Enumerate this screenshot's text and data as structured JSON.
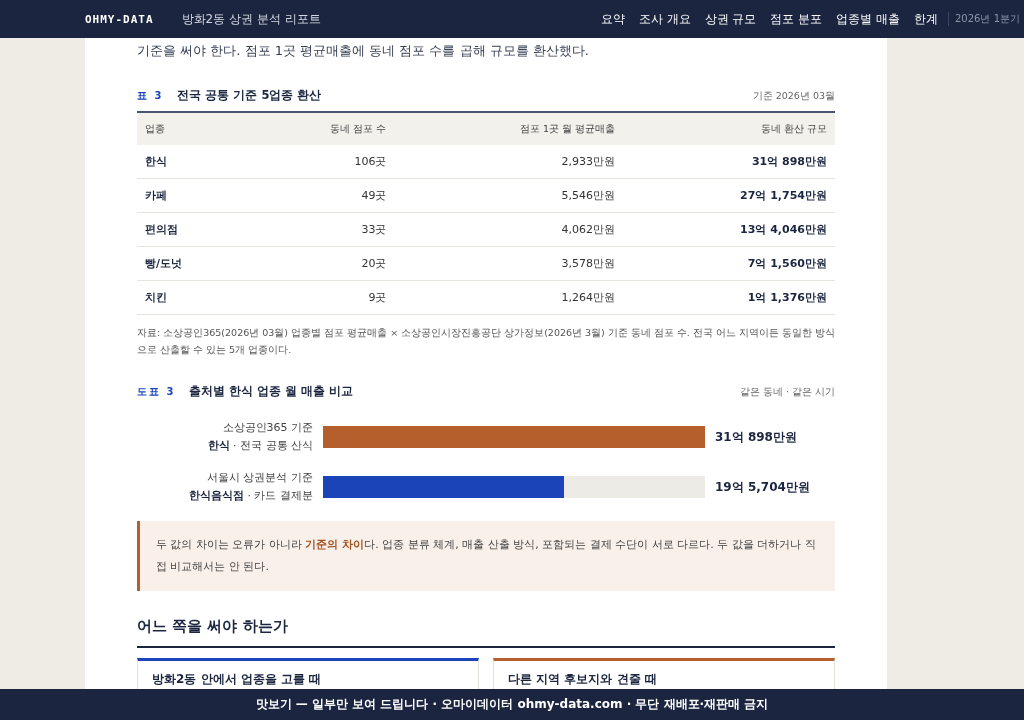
{
  "header": {
    "brand": "OHMY-DATA",
    "title": "방화2동 상권 분석 리포트",
    "nav": [
      {
        "label": "요약",
        "selected": false
      },
      {
        "label": "조사 개요",
        "selected": false
      },
      {
        "label": "상권 규모",
        "selected": false
      },
      {
        "label": "점포 분포",
        "selected": false
      },
      {
        "label": "업종별 매출",
        "selected": false
      },
      {
        "label": "한계",
        "selected": false
      }
    ],
    "period": "2026년 1분기"
  },
  "intro": "기준을 써야 한다. 점포 1곳 평균매출에 동네 점포 수를 곱해 규모를 환산했다.",
  "table": {
    "tag": "표 3",
    "title": "전국 공통 기준 5업종 환산",
    "meta": "기준 2026년 03월",
    "columns": [
      "업종",
      "동네 점포 수",
      "점포 1곳 월 평균매출",
      "동네 환산 규모"
    ],
    "rows": [
      [
        "한식",
        "106곳",
        "2,933만원",
        "31억 898만원"
      ],
      [
        "카페",
        "49곳",
        "5,546만원",
        "27억 1,754만원"
      ],
      [
        "편의점",
        "33곳",
        "4,062만원",
        "13억 4,046만원"
      ],
      [
        "빵/도넛",
        "20곳",
        "3,578만원",
        "7억 1,560만원"
      ],
      [
        "치킨",
        "9곳",
        "1,264만원",
        "1억 1,376만원"
      ]
    ],
    "source": "자료: 소상공인365(2026년 03월) 업종별 점포 평균매출 × 소상공인시장진흥공단 상가정보(2026년 3월) 기준 동네 점포 수. 전국 어느 지역이든 동일한 방식으로 산출할 수 있는 5개 업종이다."
  },
  "figure": {
    "tag": "도표 3",
    "title": "출처별 한식 업종 월 매출 비교",
    "meta": "같은 동네 · 같은 시기",
    "bars": [
      {
        "source": "소상공인365 기준",
        "label": "**한식** · 전국 공통 산식",
        "level": 1.0,
        "color": "#b5602c",
        "value": "31억 898만원"
      },
      {
        "source": "서울시 상권분석 기준",
        "label": "**한식음식점** · 카드 결제분",
        "level": 0.63,
        "color": "#1b44b8",
        "value": "19억 5,704만원"
      }
    ]
  },
  "note": "두 값의 차이는 오류가 아니라 **기준의 차이**다. 업종 분류 체계, 매출 산출 방식, 포함되는 결제 수단이 서로 다르다. 두 값을 더하거나 직접 비교해서는 안 된다.",
  "section": {
    "title": "어느 쪽을 써야 하는가",
    "cards": [
      {
        "title": "방화2동 안에서 업종을 고를 때",
        "color": "#1b44b8"
      },
      {
        "title": "다른 지역 후보지와 견줄 때",
        "color": "#b5602c"
      }
    ]
  },
  "footer": "맛보기 — 일부만 보여 드립니다 · 오마이데이터 ohmy-data.com · 무단 재배포·재판매 금지"
}
